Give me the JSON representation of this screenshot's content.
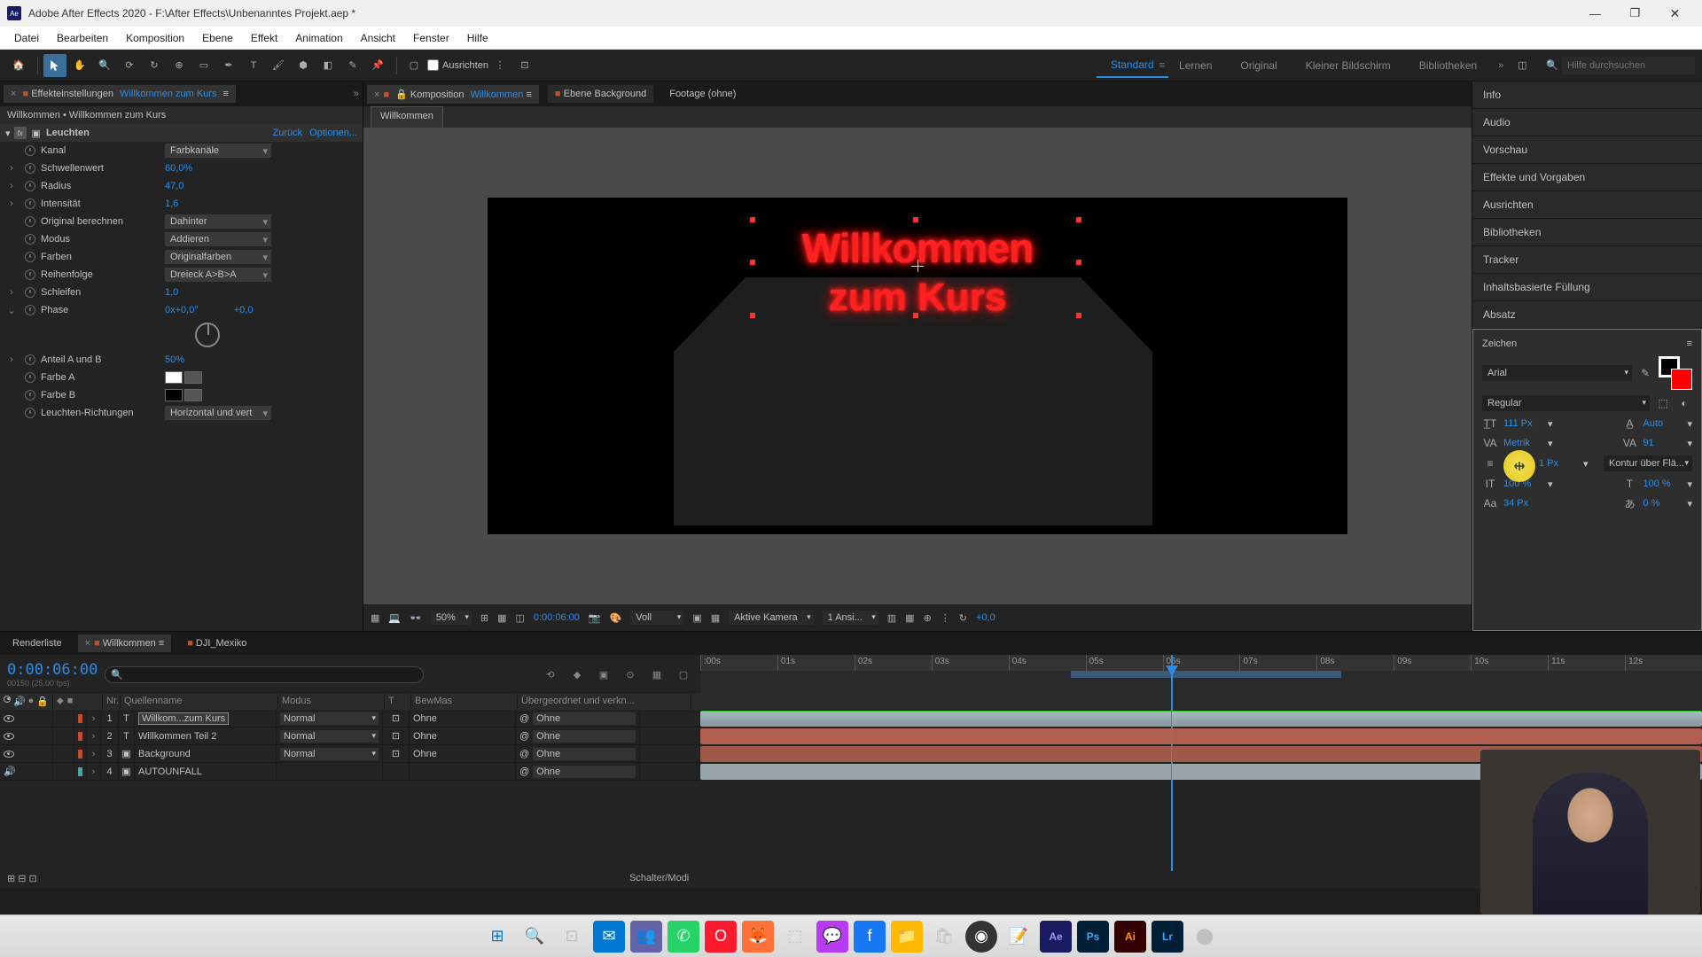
{
  "title": "Adobe After Effects 2020 - F:\\After Effects\\Unbenanntes Projekt.aep *",
  "menu": [
    "Datei",
    "Bearbeiten",
    "Komposition",
    "Ebene",
    "Effekt",
    "Animation",
    "Ansicht",
    "Fenster",
    "Hilfe"
  ],
  "toolbar": {
    "snap_label": "Ausrichten",
    "workspaces": [
      "Standard",
      "Lernen",
      "Original",
      "Kleiner Bildschirm",
      "Bibliotheken"
    ],
    "search_placeholder": "Hilfe durchsuchen"
  },
  "effect_panel": {
    "tab_label": "Effekteinstellungen",
    "tab_target": "Willkommen zum Kurs",
    "breadcrumb": "Willkommen • Willkommen zum Kurs",
    "effect_name": "Leuchten",
    "back": "Zurück",
    "options": "Optionen...",
    "props": {
      "kanal": {
        "label": "Kanal",
        "value": "Farbkanäle"
      },
      "schwelle": {
        "label": "Schwellenwert",
        "value": "60,0%"
      },
      "radius": {
        "label": "Radius",
        "value": "47,0"
      },
      "intensitaet": {
        "label": "Intensität",
        "value": "1,6"
      },
      "original": {
        "label": "Original berechnen",
        "value": "Dahinter"
      },
      "modus": {
        "label": "Modus",
        "value": "Addieren"
      },
      "farben": {
        "label": "Farben",
        "value": "Originalfarben"
      },
      "reihenfolge": {
        "label": "Reihenfolge",
        "value": "Dreieck A>B>A"
      },
      "schleifen": {
        "label": "Schleifen",
        "value": "1,0"
      },
      "phase": {
        "label": "Phase",
        "value": "0x+0,0°"
      },
      "anteil": {
        "label": "Anteil A und B",
        "value": "50%"
      },
      "farbeA": {
        "label": "Farbe A"
      },
      "farbeB": {
        "label": "Farbe B"
      },
      "richtungen": {
        "label": "Leuchten-Richtungen",
        "value": "Horizontal und vert"
      }
    }
  },
  "comp": {
    "tab1": "Komposition",
    "tab1_target": "Willkommen",
    "tab2": "Ebene Background",
    "tab3": "Footage (ohne)",
    "subtab": "Willkommen",
    "text_line1": "Willkommen",
    "text_line2": "zum Kurs",
    "zoom": "50%",
    "timecode": "0:00:06:00",
    "res": "Voll",
    "view": "Aktive Kamera",
    "views": "1 Ansi...",
    "exposure": "+0,0"
  },
  "right": {
    "panels": [
      "Info",
      "Audio",
      "Vorschau",
      "Effekte und Vorgaben",
      "Ausrichten",
      "Bibliotheken",
      "Tracker",
      "Inhaltsbasierte Füllung",
      "Absatz"
    ],
    "char": {
      "title": "Zeichen",
      "font": "Arial",
      "style": "Regular",
      "size": "111 Px",
      "leading": "Auto",
      "kerning": "Metrik",
      "tracking": "91",
      "stroke_w": "1 Px",
      "stroke_mode": "Kontur über Flä...",
      "vscale": "100 %",
      "hscale": "100 %",
      "baseline": "34 Px",
      "tsumi": "0 %"
    }
  },
  "timeline": {
    "tabs": {
      "render": "Renderliste",
      "comp": "Willkommen",
      "other": "DJI_Mexiko"
    },
    "timecode": "0:00:06:00",
    "frame_info": "00150 (25.00 fps)",
    "footer": "Schalter/Modi",
    "columns": {
      "nr": "Nr.",
      "quelle": "Quellenname",
      "modus": "Modus",
      "t": "T",
      "bm": "BewMas",
      "parent": "Übergeordnet und verkn..."
    },
    "ruler": [
      ":00s",
      "01s",
      "02s",
      "03s",
      "04s",
      "05s",
      "06s",
      "07s",
      "08s",
      "09s",
      "10s",
      "11s",
      "12s"
    ],
    "layers": [
      {
        "num": "1",
        "type": "T",
        "name": "Willkom...zum Kurs",
        "mode": "Normal",
        "bm": "Ohne",
        "parent": "Ohne",
        "color": "#c05030",
        "active": true,
        "vis": true,
        "aud": false
      },
      {
        "num": "2",
        "type": "T",
        "name": "Willkommen Teil 2",
        "mode": "Normal",
        "bm": "Ohne",
        "parent": "Ohne",
        "color": "#c05030",
        "active": false,
        "vis": true,
        "aud": false
      },
      {
        "num": "3",
        "type": "",
        "name": "Background",
        "mode": "Normal",
        "bm": "Ohne",
        "parent": "Ohne",
        "color": "#c05030",
        "active": false,
        "vis": true,
        "aud": false
      },
      {
        "num": "4",
        "type": "",
        "name": "AUTOUNFALL",
        "mode": "",
        "bm": "",
        "parent": "Ohne",
        "color": "#50a0a0",
        "active": false,
        "vis": false,
        "aud": true
      }
    ]
  },
  "taskbar": {
    "icons": [
      "windows",
      "search",
      "tasks",
      "mail",
      "teams",
      "whatsapp",
      "opera",
      "firefox",
      "app",
      "messenger",
      "facebook",
      "explorer",
      "store",
      "obs",
      "notes",
      "ae",
      "ps",
      "ai",
      "lr",
      "misc"
    ]
  }
}
